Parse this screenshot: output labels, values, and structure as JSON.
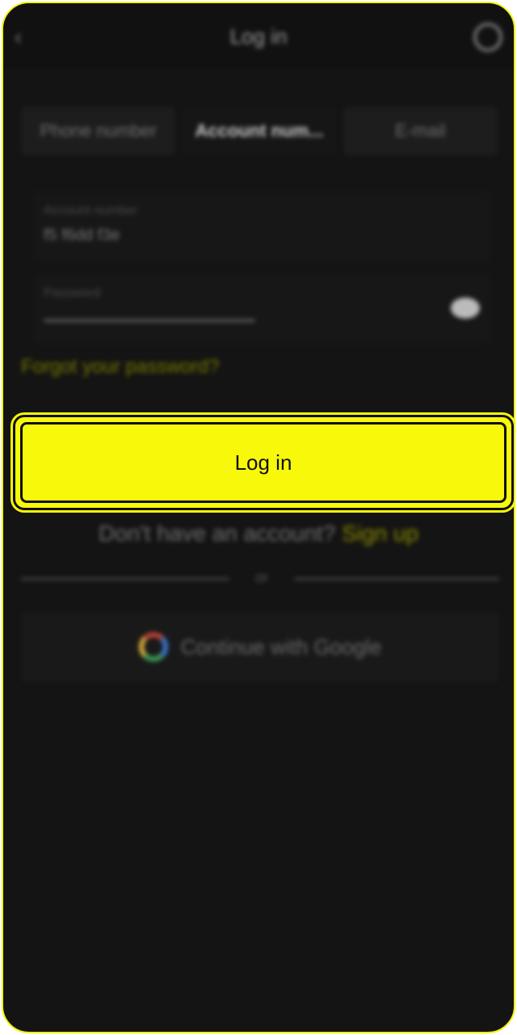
{
  "header": {
    "title": "Log in",
    "back_icon": "back-arrow-icon",
    "support_icon": "support-icon"
  },
  "tabs": [
    {
      "label": "Phone number",
      "active": false
    },
    {
      "label": "Account num...",
      "active": true
    },
    {
      "label": "E-mail",
      "active": false
    }
  ],
  "account_field": {
    "label": "Account number",
    "value": "f5 f6dd f3e"
  },
  "password_field": {
    "label": "Password",
    "eye_icon": "eye-icon"
  },
  "forgot_link": "Forgot your password?",
  "login_button": "Log in",
  "signup": {
    "text": "Don't have an account?",
    "link": "Sign up"
  },
  "divider_text": "or",
  "google_button": {
    "label": "Continue with Google",
    "icon": "google-icon"
  },
  "colors": {
    "accent": "#f8f80a",
    "background": "#141414"
  }
}
